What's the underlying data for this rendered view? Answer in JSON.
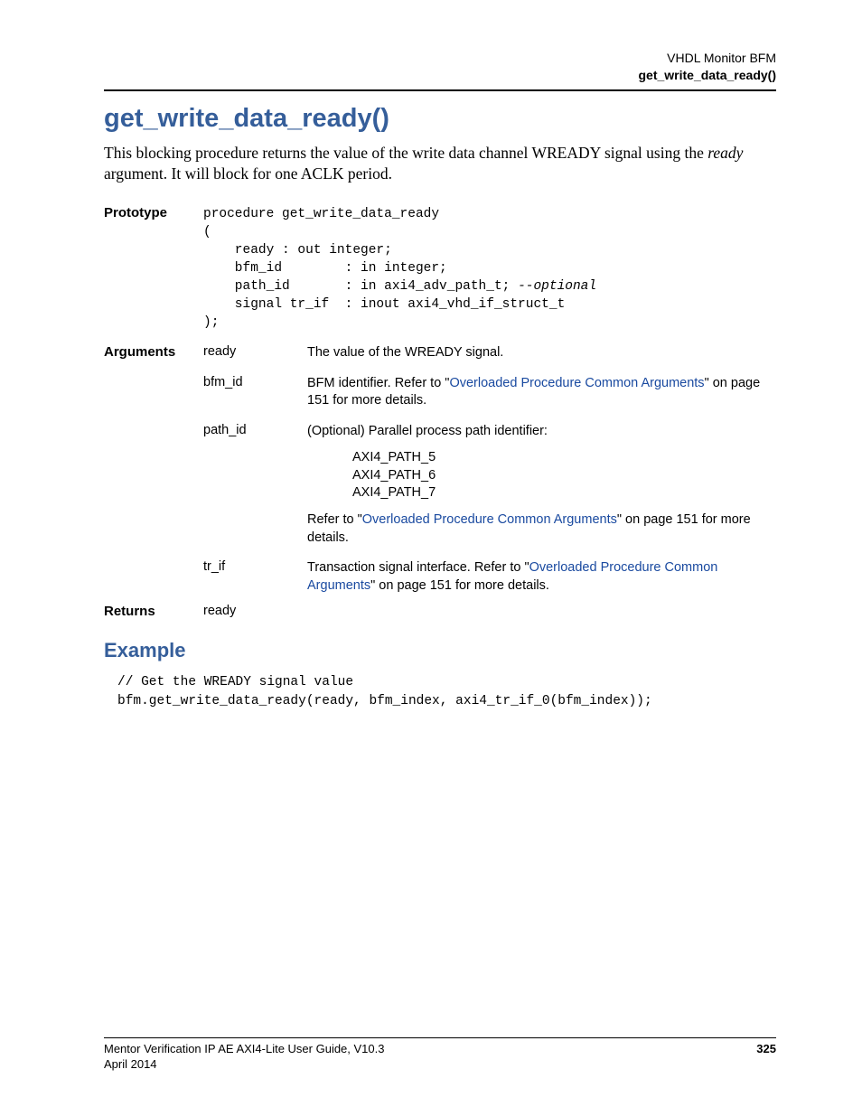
{
  "header": {
    "right1": "VHDL Monitor BFM",
    "right2": "get_write_data_ready()"
  },
  "title": "get_write_data_ready()",
  "intro": {
    "pre": "This blocking procedure returns the value of the write data channel WREADY signal using the ",
    "ital": "ready",
    "post": " argument. It will block for one ACLK period."
  },
  "prototype": {
    "label": "Prototype",
    "line1": "procedure get_write_data_ready",
    "line2": "(",
    "line3": "    ready : out integer;",
    "line4": "    bfm_id        : in integer;",
    "line5a": "    path_id       : in axi4_adv_path_t; ",
    "line5b": "--optional",
    "line6": "    signal tr_if  : inout axi4_vhd_if_struct_t",
    "line7": ");"
  },
  "arguments": {
    "label": "Arguments",
    "rows": [
      {
        "name": "ready",
        "desc": "The value of the WREADY signal."
      },
      {
        "name": "bfm_id",
        "d1": "BFM identifier. Refer to \"",
        "link": "Overloaded Procedure Common Arguments",
        "d2": "\" on page 151 for more details."
      },
      {
        "name": "path_id",
        "d1": "(Optional) Parallel process path identifier:",
        "p1": "AXI4_PATH_5",
        "p2": "AXI4_PATH_6",
        "p3": "AXI4_PATH_7",
        "d2a": "Refer to \"",
        "link": "Overloaded Procedure Common Arguments",
        "d2b": "\" on page 151 for more details."
      },
      {
        "name": "tr_if",
        "d1": "Transaction signal interface. Refer to \"",
        "link": "Overloaded Procedure Common Arguments",
        "d2": "\" on page 151 for more details."
      }
    ]
  },
  "returns": {
    "label": "Returns",
    "value": "ready"
  },
  "example": {
    "heading": "Example",
    "line1": "// Get the WREADY signal value",
    "line2": "bfm.get_write_data_ready(ready, bfm_index, axi4_tr_if_0(bfm_index));"
  },
  "footer": {
    "left": "Mentor Verification IP AE AXI4-Lite User Guide, V10.3",
    "page": "325",
    "date": "April 2014"
  }
}
